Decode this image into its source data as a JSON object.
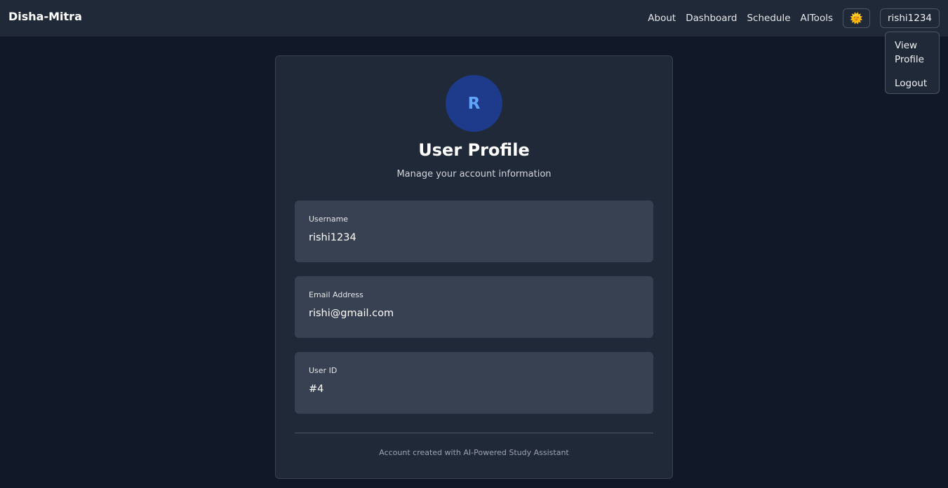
{
  "navbar": {
    "brand": "Disha-Mitra",
    "links": [
      "About",
      "Dashboard",
      "Schedule",
      "AITools"
    ],
    "theme_icon": "sun-icon",
    "theme_glyph": "🌞",
    "user_button": "rishi1234"
  },
  "dropdown": {
    "items": [
      "View Profile",
      "Logout"
    ]
  },
  "profile": {
    "avatar_initial": "R",
    "title": "User Profile",
    "subtitle": "Manage your account information",
    "fields": [
      {
        "label": "Username",
        "value": "rishi1234"
      },
      {
        "label": "Email Address",
        "value": "rishi@gmail.com"
      },
      {
        "label": "User ID",
        "value": "#4"
      }
    ],
    "footer": "Account created with AI-Powered Study Assistant"
  },
  "colors": {
    "background": "#111827",
    "card": "#1f2937",
    "field": "#374151",
    "avatar_bg": "#1e3a8a",
    "avatar_text": "#60a5fa"
  }
}
